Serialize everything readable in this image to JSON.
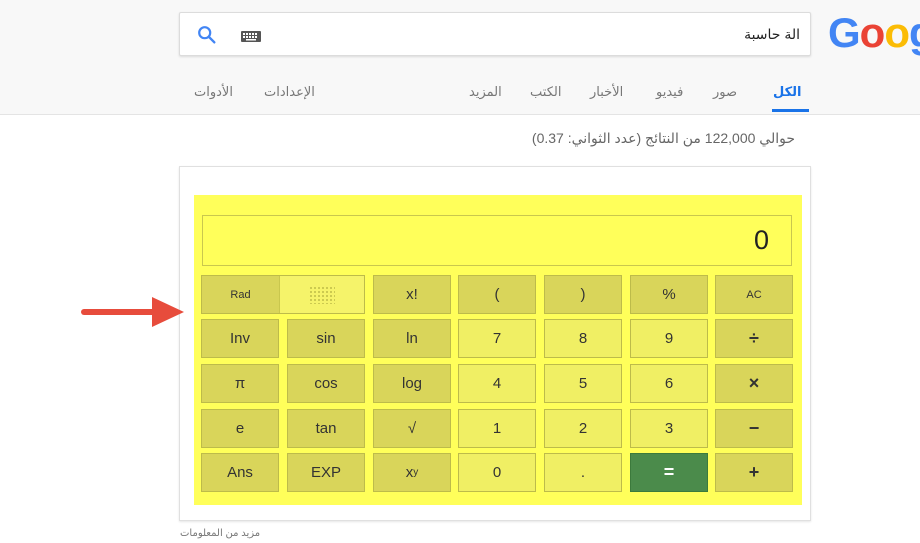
{
  "search": {
    "query": "الة حاسبة"
  },
  "logo": {
    "letters": [
      "G",
      "o",
      "o",
      "g"
    ],
    "colors": [
      "#4285F4",
      "#EA4335",
      "#FBBC05",
      "#4285F4"
    ]
  },
  "tabs": [
    {
      "label": "الكل",
      "active": true
    },
    {
      "label": "صور"
    },
    {
      "label": "فيديو"
    },
    {
      "label": "الأخبار"
    },
    {
      "label": "الكتب"
    },
    {
      "label": "المزيد"
    },
    {
      "label": "الإعدادات"
    },
    {
      "label": "الأدوات"
    }
  ],
  "result_stats": "حوالي 122,000 من النتائج (عدد الثواني: 0.37)",
  "calculator": {
    "display": "0",
    "mode": {
      "rad": "Rad"
    },
    "rows": [
      [
        "x!",
        "(",
        ")",
        "%",
        "AC"
      ],
      [
        "Inv",
        "sin",
        "ln",
        "7",
        "8",
        "9",
        "÷"
      ],
      [
        "π",
        "cos",
        "log",
        "4",
        "5",
        "6",
        "×"
      ],
      [
        "e",
        "tan",
        "√",
        "1",
        "2",
        "3",
        "−"
      ],
      [
        "Ans",
        "EXP",
        "x",
        "y",
        "0",
        ".",
        "=",
        "+"
      ]
    ]
  },
  "more_info": "مزيد من المعلومات",
  "colors": {
    "accent": "#1a73e8",
    "calc_bg": "#ffff5a",
    "equals": "#4b8b4b",
    "arrow": "#e74c3c"
  }
}
